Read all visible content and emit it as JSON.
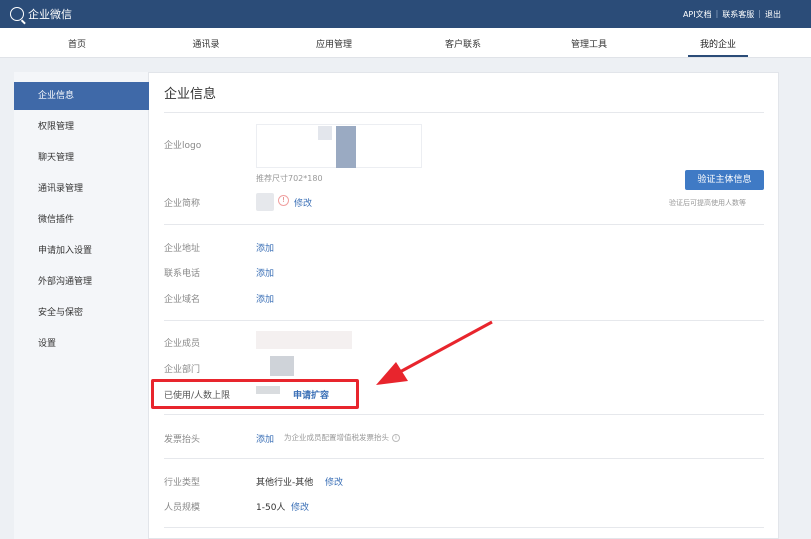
{
  "topbar": {
    "brand": "企业微信",
    "links": [
      "API文档",
      "联系客服",
      "退出"
    ],
    "separator": "|"
  },
  "nav": {
    "items": [
      "首页",
      "通讯录",
      "应用管理",
      "客户联系",
      "管理工具",
      "我的企业"
    ],
    "active_index": 5
  },
  "sidebar": {
    "items": [
      "企业信息",
      "权限管理",
      "聊天管理",
      "通讯录管理",
      "微信插件",
      "申请加入设置",
      "外部沟通管理",
      "安全与保密",
      "设置"
    ],
    "active_index": 0
  },
  "main": {
    "title": "企业信息",
    "logo_label": "企业logo",
    "logo_hint": "推荐尺寸702*180",
    "verify_button": "验证主体信息",
    "verify_note": "验证后可提高使用人数等",
    "abbr_label": "企业简称",
    "abbr_edit": "修改",
    "address_label": "企业地址",
    "address_action": "添加",
    "phone_label": "联系电话",
    "phone_action": "添加",
    "domain_label": "企业域名",
    "domain_action": "添加",
    "members_label": "企业成员",
    "dept_label": "企业部门",
    "used_label": "已使用/人数上限",
    "expand_link": "申请扩容",
    "invoice_label": "发票抬头",
    "invoice_action": "添加",
    "invoice_hint": "为企业成员配置增值税发票抬头",
    "industry_label": "行业类型",
    "industry_value": "其他行业-其他",
    "industry_edit": "修改",
    "scale_label": "人员规模",
    "scale_value": "1-50人",
    "scale_edit": "修改"
  },
  "colors": {
    "topbar": "#2b4c78",
    "accent": "#3f69a8",
    "link": "#3a6fb6",
    "highlight": "#e8252d"
  }
}
